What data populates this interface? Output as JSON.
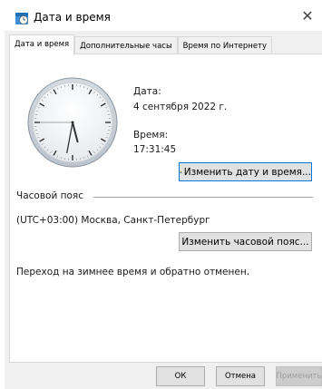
{
  "window": {
    "title": "Дата и время",
    "close_glyph": "✕"
  },
  "tabs": [
    {
      "label": "Дата и время",
      "active": true
    },
    {
      "label": "Дополнительные часы",
      "active": false
    },
    {
      "label": "Время по Интернету",
      "active": false
    }
  ],
  "datetime": {
    "date_label": "Дата:",
    "date_value": "4 сентября 2022 г.",
    "time_label": "Время:",
    "time_value": "17:31:45",
    "change_button": "Изменить дату и время..."
  },
  "clock": {
    "hours": 17,
    "minutes": 31,
    "seconds": 45
  },
  "timezone": {
    "section_label": "Часовой пояс",
    "value": "(UTC+03:00) Москва, Санкт-Петербург",
    "change_button": "Изменить часовой пояс..."
  },
  "dst_note": "Переход на зимнее время и обратно отменен.",
  "footer": {
    "ok": "ОК",
    "cancel": "Отмена",
    "apply": "Применить"
  },
  "colors": {
    "frame": "#f0f0f0",
    "accent_blue": "#0078d7",
    "shield_blue": "#1f5fbf",
    "shield_yellow": "#f2c200"
  }
}
